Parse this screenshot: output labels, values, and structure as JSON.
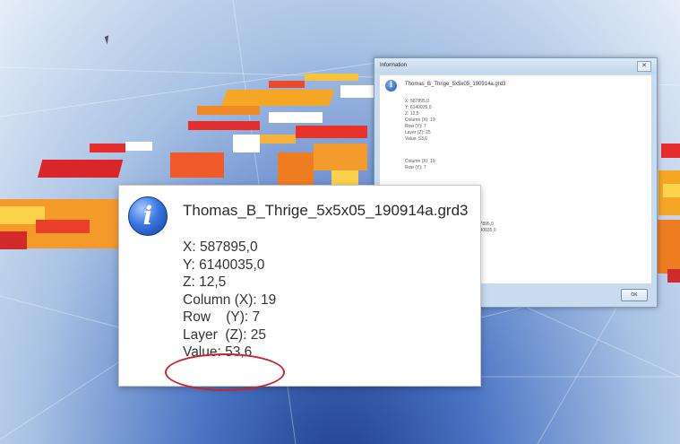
{
  "background_dialog": {
    "title": "Information",
    "close_glyph": "✕",
    "filename": "Thomas_B_Thrige_5x5x05_190914a.grd3",
    "values": [
      "X: 587895,0",
      "Y: 6140035,0",
      "Z: 12,5",
      "Column (X): 19",
      "Row (Y): 7",
      "Layer (Z): 25",
      "Value: 53,6"
    ],
    "values2": [
      "Column (X): 19",
      "Row (Y): 7",
      "587895,0",
      "6140035,0"
    ],
    "ok_label": "OK"
  },
  "zoom_dialog": {
    "icon_glyph": "i",
    "filename": "Thomas_B_Thrige_5x5x05_190914a.grd3",
    "lines": [
      "X: 587895,0",
      "Y: 6140035,0",
      "Z: 12,5",
      "Column (X): 19",
      "Row    (Y): 7",
      "Layer  (Z): 25",
      "Value: 53,6"
    ]
  },
  "colors": {
    "accent_red": "#c8262f",
    "info_blue": "#1d4fb8"
  }
}
